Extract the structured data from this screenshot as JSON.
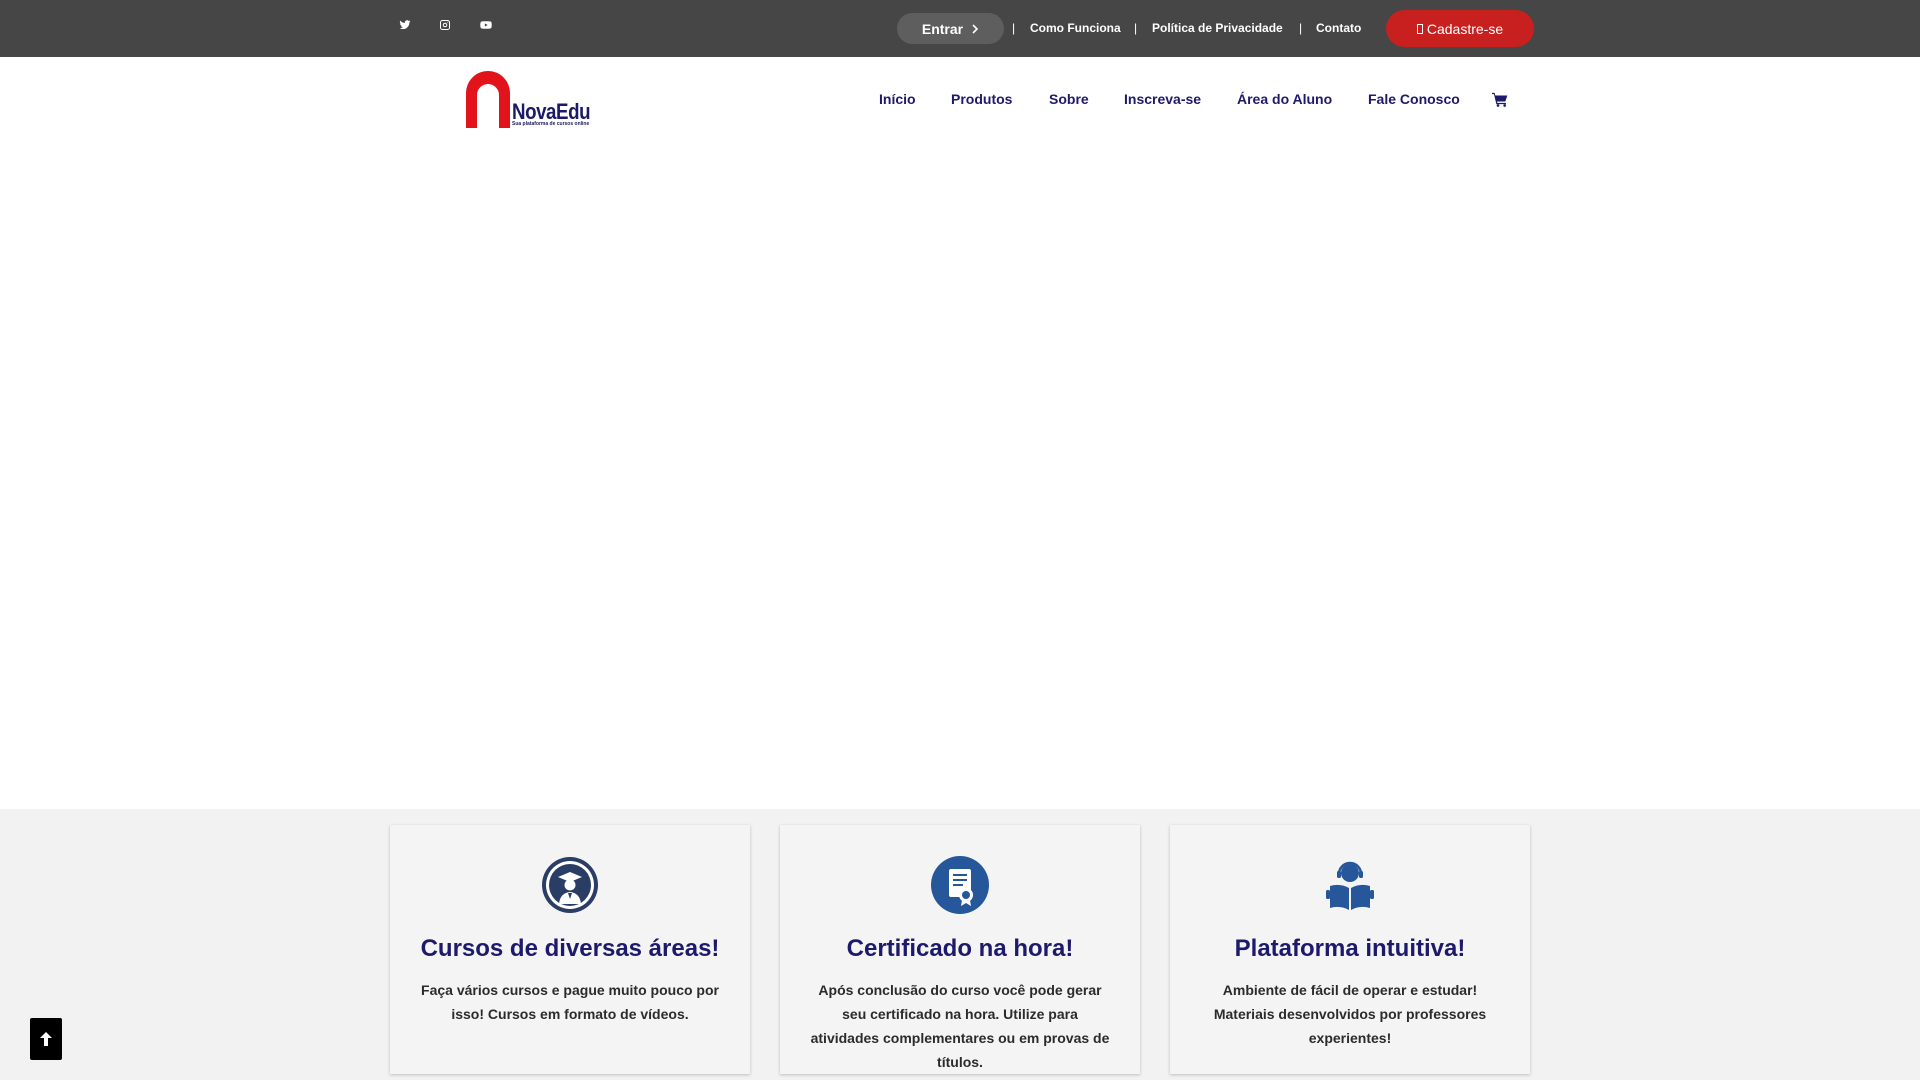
{
  "topbar": {
    "social": [
      "twitter-icon",
      "instagram-icon",
      "youtube-icon"
    ],
    "login_label": "Entrar",
    "links": [
      "Como Funciona",
      "Política de Privacidade",
      "Contato"
    ],
    "separator": "|",
    "signup_label": "Cadastre-se",
    "signup_color": "#c7201f",
    "bar_color": "#464646"
  },
  "header": {
    "logo_name": "NovaEdu",
    "logo_tagline": "Sua plataforma de cursos online",
    "nav": [
      "Início",
      "Produtos",
      "Sobre",
      "Inscreva-se",
      "Área do Aluno",
      "Fale Conosco"
    ],
    "cart_icon": "cart-icon",
    "nav_color": "#1e1a6b"
  },
  "features": [
    {
      "icon": "graduate-icon",
      "title": "Cursos de diversas áreas!",
      "text": "Faça vários cursos e pague muito pouco por isso! Cursos em formato de vídeos."
    },
    {
      "icon": "certificate-icon",
      "title": "Certificado na hora!",
      "text": "Após conclusão do curso você pode gerar seu certificado na hora. Utilize para atividades complementares ou em provas de títulos."
    },
    {
      "icon": "support-reading-icon",
      "title": "Plataforma intuitiva!",
      "text": "Ambiente de fácil de operar e estudar! Materiais desenvolvidos por professores experientes!"
    }
  ],
  "scroll_top_icon": "arrow-up-icon"
}
